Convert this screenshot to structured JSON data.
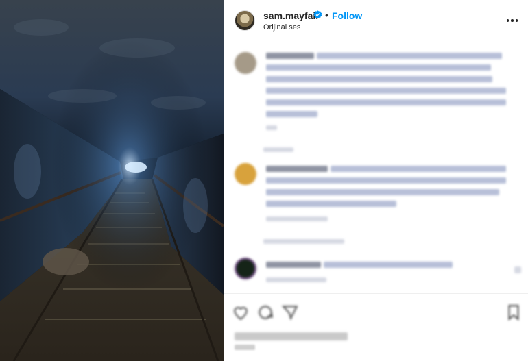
{
  "post": {
    "username": "sam.mayfair",
    "separator": "•",
    "follow_label": "Follow",
    "audio_label": "Orijinal ses"
  },
  "icons": {
    "verified": "verified-badge-icon",
    "more": "more-options-icon",
    "like": "heart-icon",
    "comment": "comment-icon",
    "share": "share-icon",
    "save": "bookmark-icon"
  },
  "colors": {
    "accent": "#0095f6",
    "text": "#262626"
  }
}
